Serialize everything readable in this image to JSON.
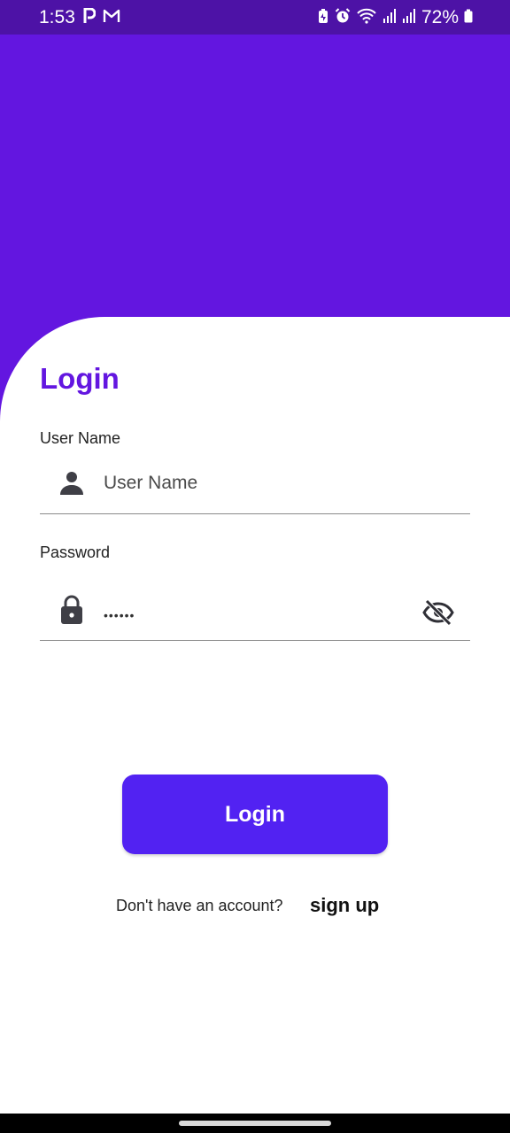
{
  "status_bar": {
    "time": "1:53",
    "battery": "72%",
    "left_icons": [
      "parking-icon",
      "gmail-icon"
    ],
    "right_icons": [
      "battery-saver-icon",
      "alarm-icon",
      "wifi-icon",
      "signal-icon",
      "signal-icon",
      "battery-icon"
    ]
  },
  "login": {
    "title": "Login",
    "username_label": "User Name",
    "username_placeholder": "User Name",
    "username_value": "",
    "password_label": "Password",
    "password_value": "••••••",
    "password_icon": "lock-icon",
    "username_icon": "person-icon",
    "visibility_icon": "visibility-off-icon",
    "button_label": "Login",
    "signup_prompt": "Don't have an account?",
    "signup_link": "sign up"
  },
  "colors": {
    "status_bar": "#4d12a6",
    "header": "#6316e0",
    "title": "#6316e0",
    "button": "#5222f2"
  }
}
